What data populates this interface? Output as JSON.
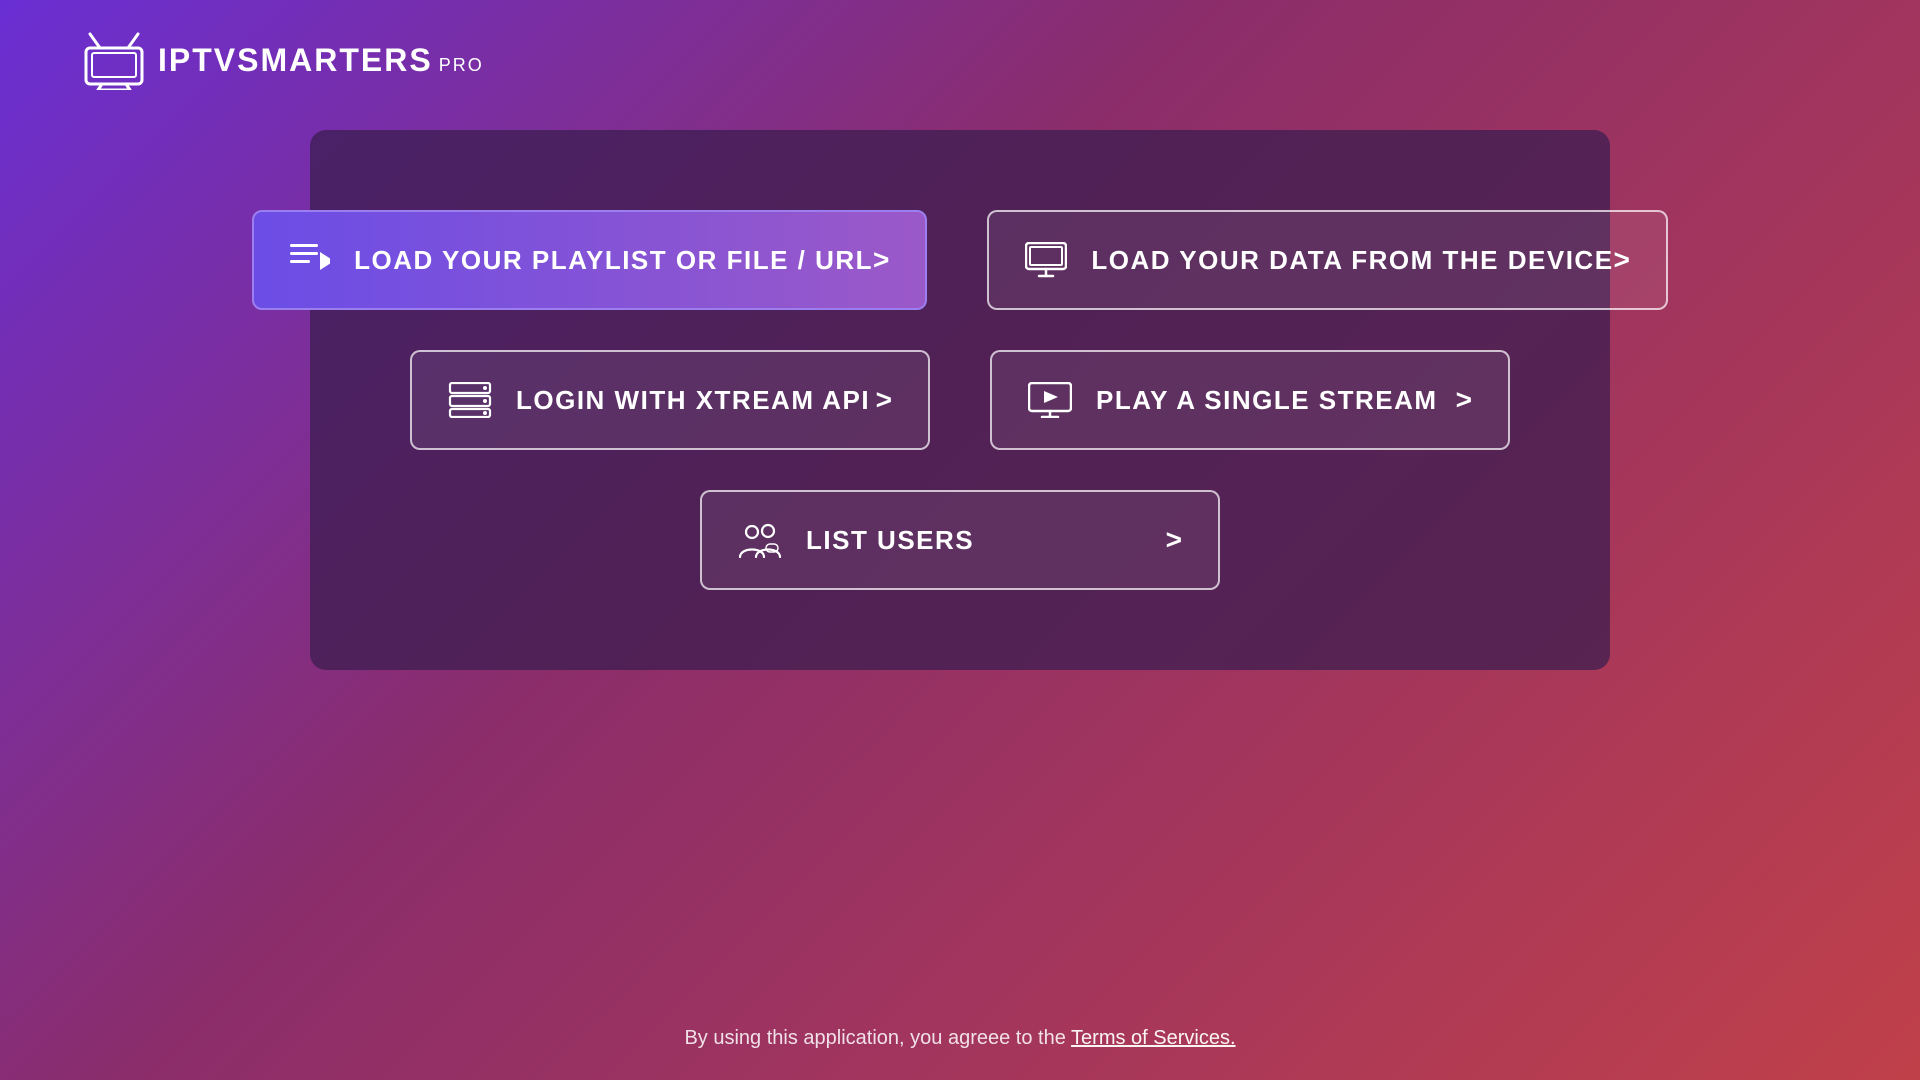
{
  "app": {
    "title": "IPTV SMARTERS PRO",
    "logo_iptv": "IPTV",
    "logo_smarters": "SMARTERS",
    "logo_pro": "PRO"
  },
  "buttons": {
    "playlist": {
      "label": "LOAD YOUR PLAYLIST OR FILE / URL",
      "active": true
    },
    "device": {
      "label": "LOAD YOUR DATA FROM THE DEVICE",
      "active": false
    },
    "xtream": {
      "label": "LOGIN WITH XTREAM API",
      "active": false
    },
    "stream": {
      "label": "PLAY A SINGLE STREAM",
      "active": false
    },
    "users": {
      "label": "LIST USERS",
      "active": false
    }
  },
  "footer": {
    "text": "By using this application, you agreee to the ",
    "link": "Terms of Services."
  }
}
